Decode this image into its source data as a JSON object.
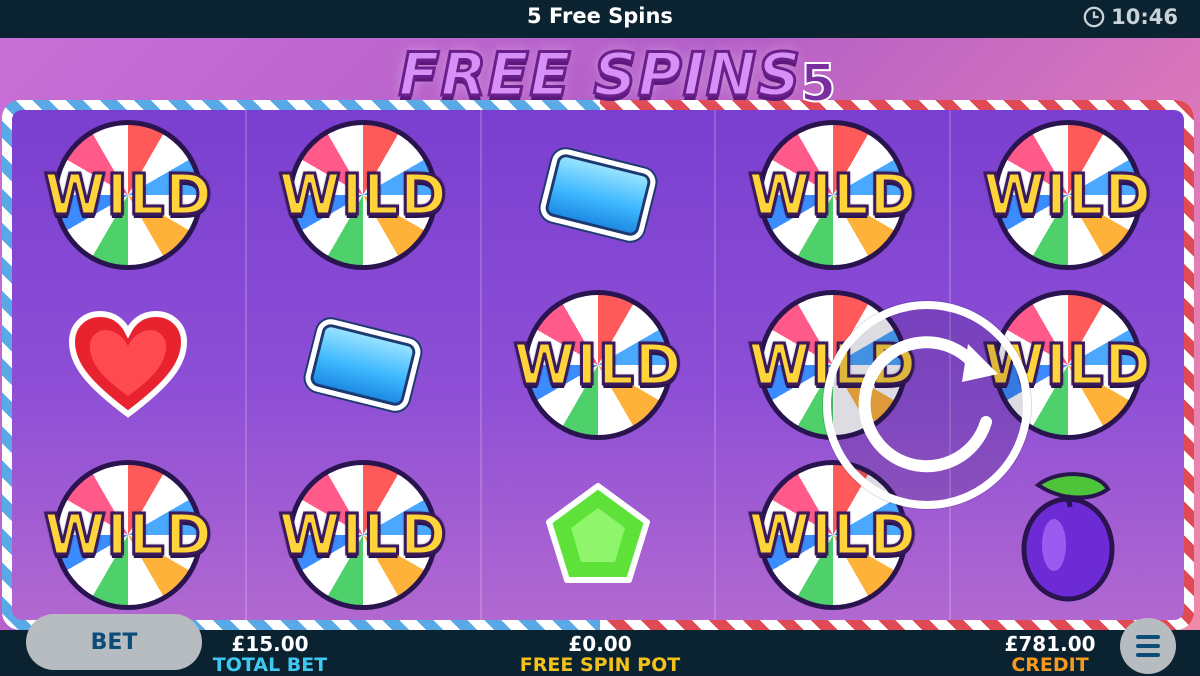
{
  "header": {
    "title": "5 Free Spins",
    "time": "10:46"
  },
  "banner": {
    "text": "FREE SPINS",
    "count": "5"
  },
  "reels": [
    [
      "WILD",
      "heart",
      "WILD"
    ],
    [
      "WILD",
      "blue-gem",
      "WILD"
    ],
    [
      "blue-gem",
      "WILD",
      "green-gem"
    ],
    [
      "WILD",
      "WILD",
      "WILD"
    ],
    [
      "WILD",
      "WILD",
      "plum"
    ]
  ],
  "symbol_label": "WILD",
  "footer": {
    "bet_label": "BET",
    "total_bet": {
      "value": "£15.00",
      "label": "TOTAL BET"
    },
    "free_spin_pot": {
      "value": "£0.00",
      "label": "FREE SPIN POT"
    },
    "credit": {
      "value": "£781.00",
      "label": "CREDIT"
    }
  },
  "colors": {
    "total_bet_label": "#3fc8f0",
    "free_spin_pot_label": "#f2c21a",
    "credit_label": "#f59a1c"
  }
}
